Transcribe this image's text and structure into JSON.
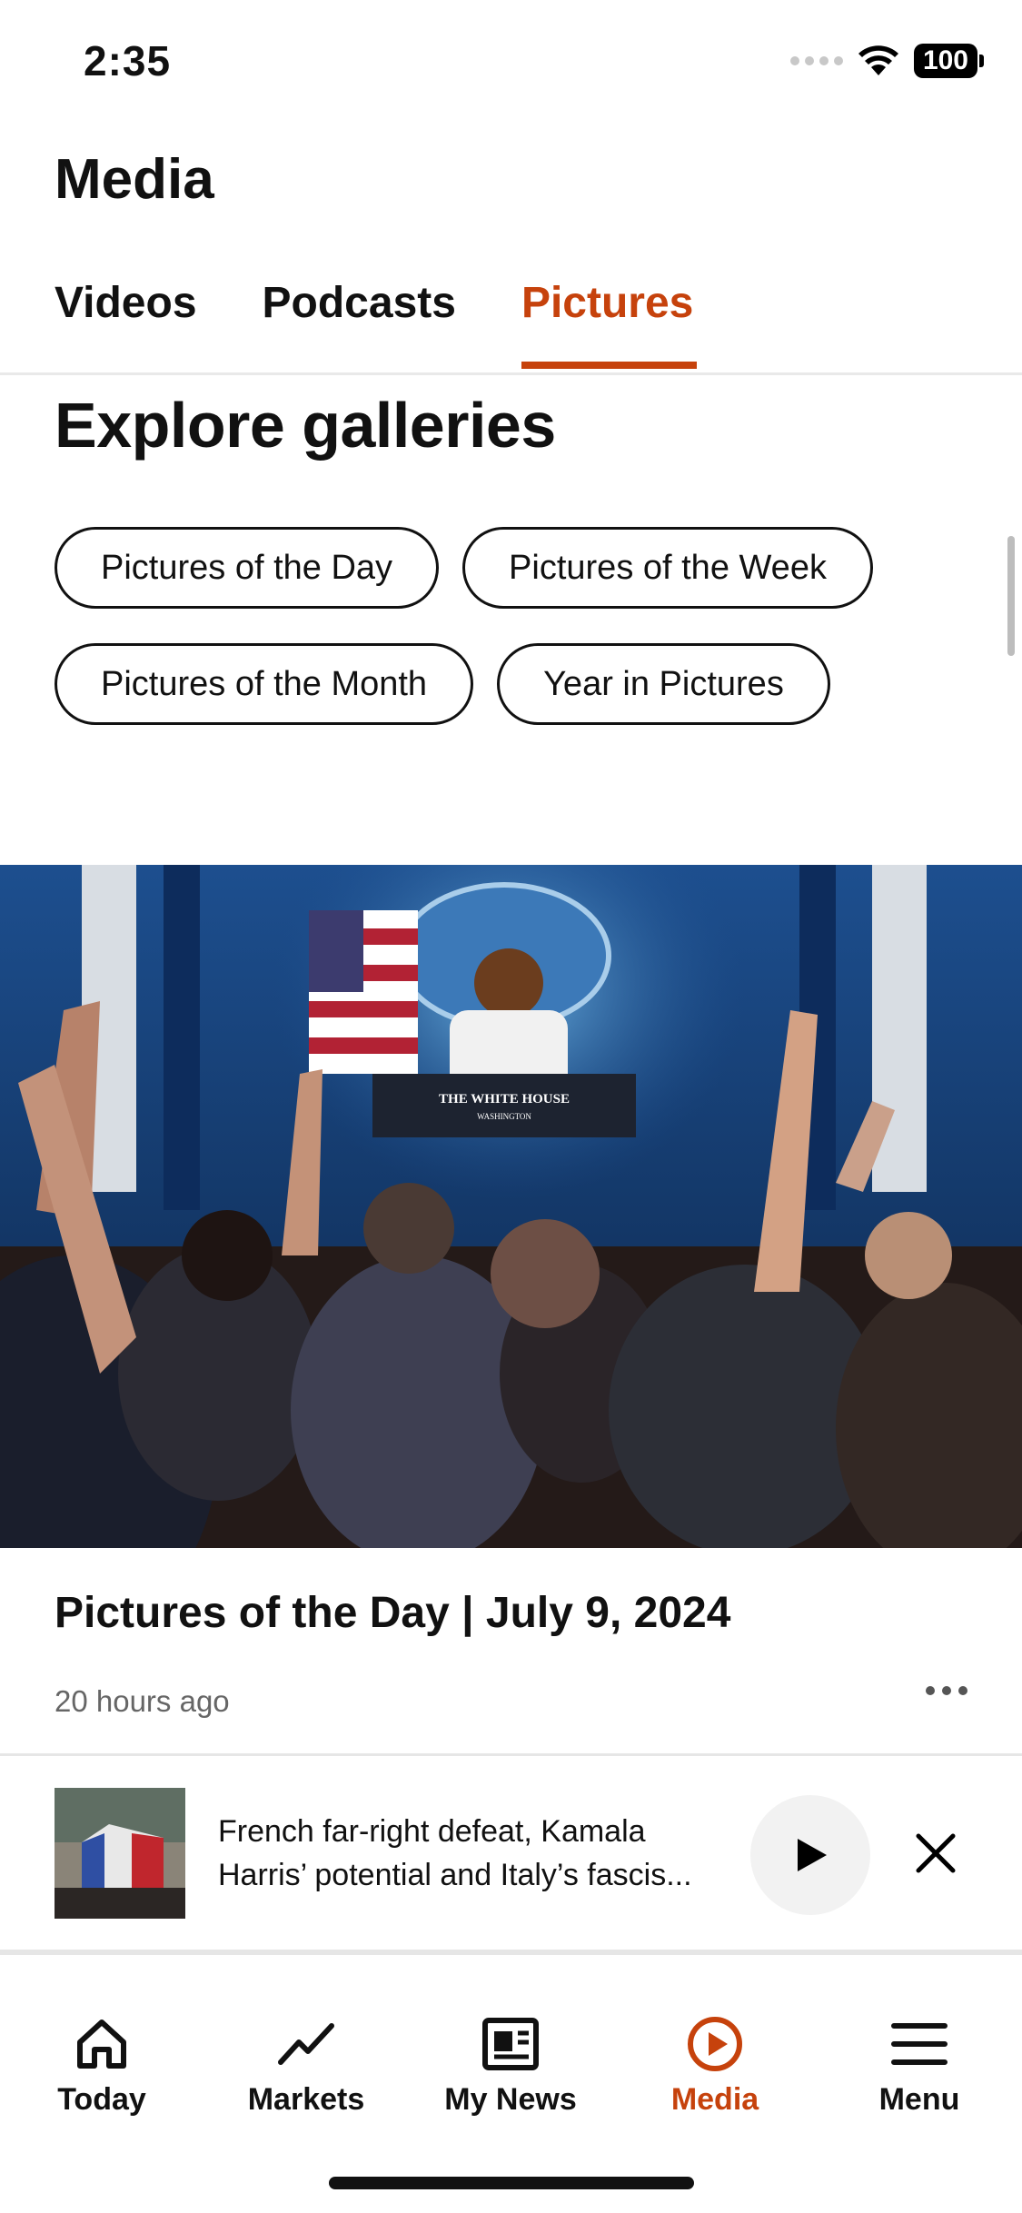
{
  "status_bar": {
    "time": "2:35",
    "battery": "100"
  },
  "header": {
    "title": "Media"
  },
  "tabs": [
    {
      "label": "Videos",
      "active": false
    },
    {
      "label": "Podcasts",
      "active": false
    },
    {
      "label": "Pictures",
      "active": true
    }
  ],
  "galleries": {
    "title": "Explore galleries",
    "chips": [
      "Pictures of the Day",
      "Pictures of the Week",
      "Pictures of the Month",
      "Year in Pictures"
    ]
  },
  "hero": {
    "sign_line1": "THE WHITE HOUSE",
    "sign_line2": "WASHINGTON"
  },
  "article": {
    "title": "Pictures of the Day | July 9, 2024",
    "time": "20 hours ago"
  },
  "player": {
    "line1": "French far-right defeat, Kamala",
    "line2": "Harris’ potential and Italy’s fascis..."
  },
  "nav": [
    {
      "label": "Today",
      "icon": "home-icon"
    },
    {
      "label": "Markets",
      "icon": "chart-line-icon"
    },
    {
      "label": "My News",
      "icon": "news-icon"
    },
    {
      "label": "Media",
      "icon": "play-circle-icon",
      "active": true
    },
    {
      "label": "Menu",
      "icon": "menu-icon"
    }
  ],
  "colors": {
    "accent": "#c6420c",
    "text": "#111111",
    "muted": "#666666"
  }
}
